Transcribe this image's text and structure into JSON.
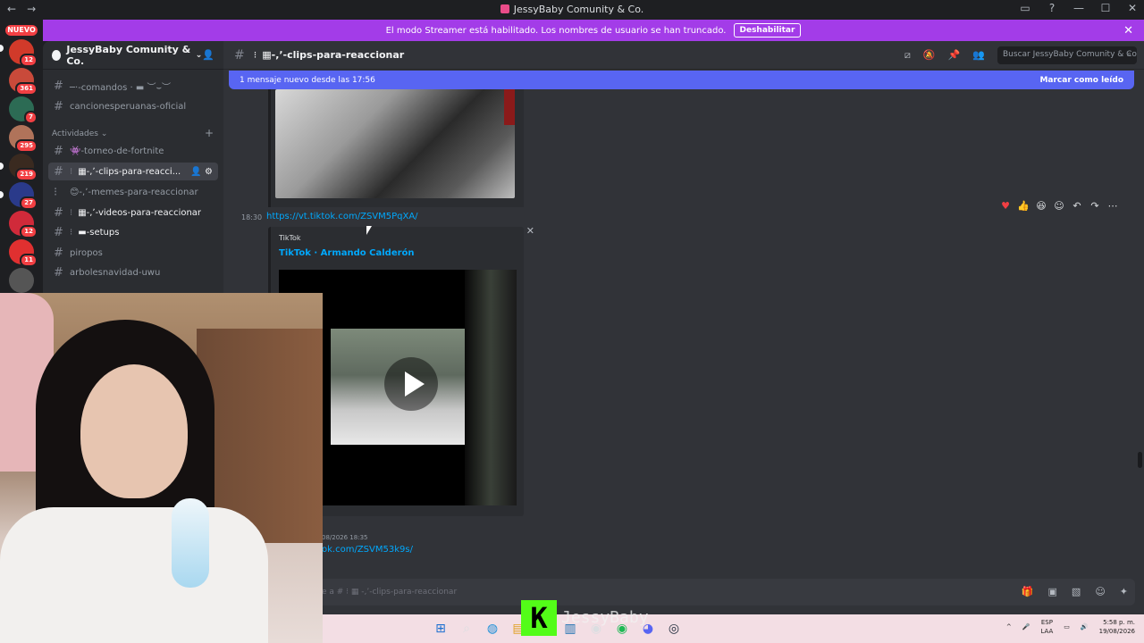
{
  "window": {
    "title": "JessyBaby Comunity & Co.",
    "back": "←",
    "forward": "→",
    "controls": [
      "▭",
      "?",
      "—",
      "☐",
      "✕"
    ]
  },
  "banner": {
    "text": "El modo Streamer está habilitado. Los nombres de usuario se han truncado.",
    "button": "Deshabilitar",
    "close": "✕",
    "color": "#a33ce8"
  },
  "guilds": {
    "nuevo": "NUEVO",
    "badges": [
      "12",
      "361",
      "7",
      "295",
      "219",
      "27",
      "12",
      "11"
    ]
  },
  "server": {
    "name": "JessyBaby Comunity & Co.",
    "caret": "⌄",
    "add_user": "👤"
  },
  "channels": {
    "items": [
      {
        "label": "─·-comandos · ▬ ︶⌣︶",
        "prefix": "#"
      },
      {
        "label": "cancionesperuanas-oficial",
        "prefix": "#"
      },
      {
        "label": "👾-torneo-de-fortnite",
        "prefix": "#"
      },
      {
        "label": "▦-,ʼ-clips-para-reacci...",
        "prefix": "#"
      },
      {
        "label": "😊-,ʼ-memes-para-reaccionar",
        "prefix": "⁝"
      },
      {
        "label": "▦-,ʼ-videos-para-reaccionar",
        "prefix": "#"
      },
      {
        "label": "▬-setups",
        "prefix": "#"
      },
      {
        "label": "piropos",
        "prefix": "#"
      },
      {
        "label": "arbolesnavidad-uwu",
        "prefix": "#"
      }
    ],
    "category": "Actividades ⌄",
    "category_plus": "+"
  },
  "header": {
    "channel": "▦-,ʼ-clips-para-reaccionar",
    "search_placeholder": "Buscar JessyBaby Comunity & Co."
  },
  "newbar": {
    "text": "1 mensaje nuevo desde las 17:56",
    "mark": "Marcar como leído"
  },
  "message": {
    "time": "18:30",
    "link": "https://vt.tiktok.com/ZSVM5PqXA/",
    "provider": "TikTok",
    "title": "TikTok · Armando Calderón"
  },
  "message2": {
    "time": "08/2026 18:35",
    "link": "ok.com/ZSVM53k9s/"
  },
  "composer": {
    "placeholder": "e a # ⁝ ▦ -,ʼ-clips-para-reaccionar"
  },
  "kick": {
    "logo": "K",
    "name": "JessyBaby"
  },
  "taskbar": {
    "lang1": "ESP",
    "lang2": "LAA",
    "time": "5:58 p. m.",
    "date": "19/08/2026"
  }
}
